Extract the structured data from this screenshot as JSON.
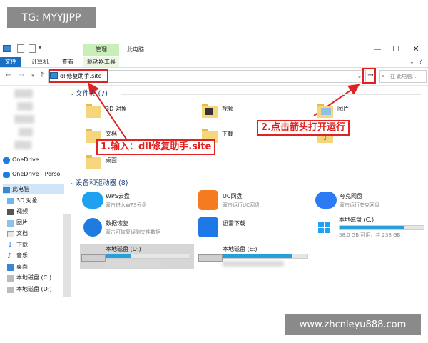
{
  "watermarks": {
    "top_left": "TG: MYYJJPP",
    "bottom_right": "www.zhcnleyu888.com"
  },
  "window": {
    "context_tab": "管理",
    "title": "此电脑",
    "min": "—",
    "max": "☐",
    "close": "✕"
  },
  "ribbon": {
    "tabs": [
      "文件",
      "计算机",
      "查看",
      "驱动器工具"
    ],
    "help": "?"
  },
  "nav": {
    "back": "←",
    "forward": "→",
    "up": "↑",
    "address": "dll修复助手.site",
    "go": "→",
    "search_placeholder": "在 此电脑..."
  },
  "annotations": {
    "step1": "1.输入：dll修复助手.site",
    "step2": "2.点击箭头打开运行"
  },
  "sidebar": {
    "items": [
      "OneDrive",
      "OneDrive - Perso",
      "此电脑",
      "3D 对象",
      "视频",
      "图片",
      "文档",
      "下载",
      "音乐",
      "桌面",
      "本地磁盘 (C:)",
      "本地磁盘 (D:)"
    ]
  },
  "folders": {
    "header": "文件夹 (7)",
    "items": [
      "3D 对象",
      "视频",
      "图片",
      "文档",
      "下载",
      "音乐",
      "桌面"
    ]
  },
  "devices": {
    "header": "设备和驱动器 (8)",
    "items": [
      {
        "name": "WPS云盘",
        "desc": "双击进入WPS云盘"
      },
      {
        "name": "UC网盘",
        "desc": "双击运行UC网盘"
      },
      {
        "name": "夸克网盘",
        "desc": "双击运行夸克网盘"
      },
      {
        "name": "数据恢复",
        "desc": "双击可恢复误删文件数据"
      },
      {
        "name": "迅雷下载",
        "desc": ""
      },
      {
        "name": "本地磁盘 (C:)",
        "desc": "58.0 GB 可用，共 238 GB"
      },
      {
        "name": "本地磁盘 (D:)",
        "desc": ""
      },
      {
        "name": "本地磁盘 (E:)",
        "desc": ""
      }
    ],
    "c_fill": 0.76,
    "d_fill": 0.3,
    "e_fill": 0.82
  }
}
